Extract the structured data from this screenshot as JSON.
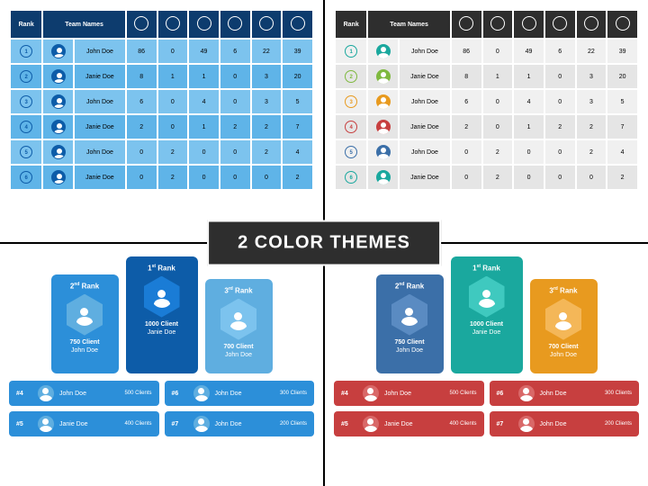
{
  "banner": "2 COLOR THEMES",
  "headers": {
    "rank": "Rank",
    "team": "Team Names"
  },
  "rows": [
    {
      "rank": "1",
      "name": "John Doe",
      "v": [
        86,
        0,
        49,
        6,
        22,
        39
      ]
    },
    {
      "rank": "2",
      "name": "Janie Doe",
      "v": [
        8,
        1,
        1,
        0,
        3,
        20
      ]
    },
    {
      "rank": "3",
      "name": "John Doe",
      "v": [
        6,
        0,
        4,
        0,
        3,
        5
      ]
    },
    {
      "rank": "4",
      "name": "Janie Doe",
      "v": [
        2,
        0,
        1,
        2,
        2,
        7
      ]
    },
    {
      "rank": "5",
      "name": "John Doe",
      "v": [
        0,
        2,
        0,
        0,
        2,
        4
      ]
    },
    {
      "rank": "6",
      "name": "Janie Doe",
      "v": [
        0,
        2,
        0,
        0,
        0,
        2
      ]
    }
  ],
  "podium": {
    "first": {
      "title": "1st Rank",
      "sup": "st",
      "clients": "1000 Client",
      "name": "Janie Doe"
    },
    "second": {
      "title": "2nd Rank",
      "sup": "nd",
      "clients": "750 Client",
      "name": "John Doe"
    },
    "third": {
      "title": "3rd Rank",
      "sup": "rd",
      "clients": "700 Client",
      "name": "John Doe"
    }
  },
  "bars": [
    {
      "rank": "#4",
      "name": "John Doe",
      "clients": "500 Clients"
    },
    {
      "rank": "#6",
      "name": "John Doe",
      "clients": "300 Clients"
    },
    {
      "rank": "#5",
      "name": "Janie Doe",
      "clients": "400 Clients"
    },
    {
      "rank": "#7",
      "name": "John Doe",
      "clients": "200 Clients"
    }
  ]
}
